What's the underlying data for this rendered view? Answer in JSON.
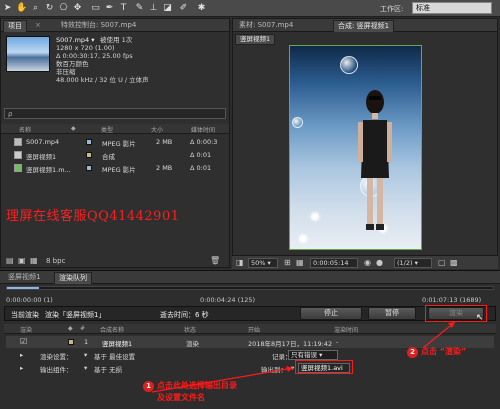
{
  "toolbar": {
    "workspace_label": "工作区:",
    "workspace_value": "标准"
  },
  "project_panel": {
    "tab_label": "项目",
    "tab2_label": "特效控制台: S007.mp4",
    "file_name": "S007.mp4 ▾",
    "used_label": "被使用 1次",
    "resolution": "1280 x 720 (1.00)",
    "duration": "Δ 0:00:30:17, 25.00 fps",
    "color_mode": "数百万颜色",
    "interlace": "非压缩",
    "audio": "48.000 kHz / 32 位 U / 立体声",
    "search_placeholder": "ρ",
    "columns": {
      "name": "名称",
      "type": "类型",
      "size": "大小",
      "duration": "媒体时间"
    },
    "rows": [
      {
        "name": "S007.mp4",
        "type": "MPEG 影片",
        "size": "2 MB",
        "duration": "Δ 0:00:3"
      },
      {
        "name": "竖屏视频1",
        "type": "合成",
        "size": "",
        "duration": "Δ 0:01"
      },
      {
        "name": "竖屏视频1.m...",
        "type": "MPEG 影片",
        "size": "2 MB",
        "duration": "Δ 0:01"
      }
    ],
    "bpc": "8 bpc"
  },
  "watermark": "理屏在线客服QQ41442901",
  "viewer_panel": {
    "footage_tab": "素材: S007.mp4",
    "comp_tab": "合成: 竖屏视频1",
    "comp_subtab": "竖屏视频1",
    "zoom": "50%",
    "timecode": "0:00:05:14",
    "resolution": "(1/2)"
  },
  "render_queue": {
    "tabs": [
      "竖屏视频1",
      "渲染队列"
    ],
    "time_start": "0:00:00:00 (1)",
    "time_mid": "0:00:04:24 (125)",
    "time_end": "0:01:07:13 (1689)",
    "current_render_label": "当前渲染",
    "rendering_label": "渲染「竖屏视频1」",
    "elapsed_label": "逝去时间：6 秒",
    "stop_button": "停止",
    "pause_button": "暂停",
    "render_button": "渲染",
    "columns": {
      "render": "渲染",
      "tag": "#",
      "comp_name": "合成名称",
      "status": "状态",
      "started": "开始",
      "render_time": "渲染时间"
    },
    "item": {
      "index": "1",
      "comp": "竖屏视频1",
      "status": "渲染",
      "started": "2018年8月17日，11:19:42",
      "render_time": "-"
    },
    "render_settings_label": "渲染设置：",
    "render_settings_value": "基于 最佳设置",
    "log_label": "记录：",
    "log_value": "只有错误",
    "output_module_label": "输出组件：",
    "output_module_value": "基于 无损",
    "output_to_label": "输出到：",
    "output_to_value": "竖屏视频1.avi"
  },
  "annotations": {
    "step1_number": "1",
    "step1_text": "点击此处选择输出目录",
    "step1_text2": "及设置文件名",
    "step2_number": "2",
    "step2_text": "点击 “渲染”"
  },
  "colors": {
    "accent_red": "#ff1a1a",
    "panel_bg": "#2f2f2f",
    "progress_green": "#6aa84f"
  }
}
